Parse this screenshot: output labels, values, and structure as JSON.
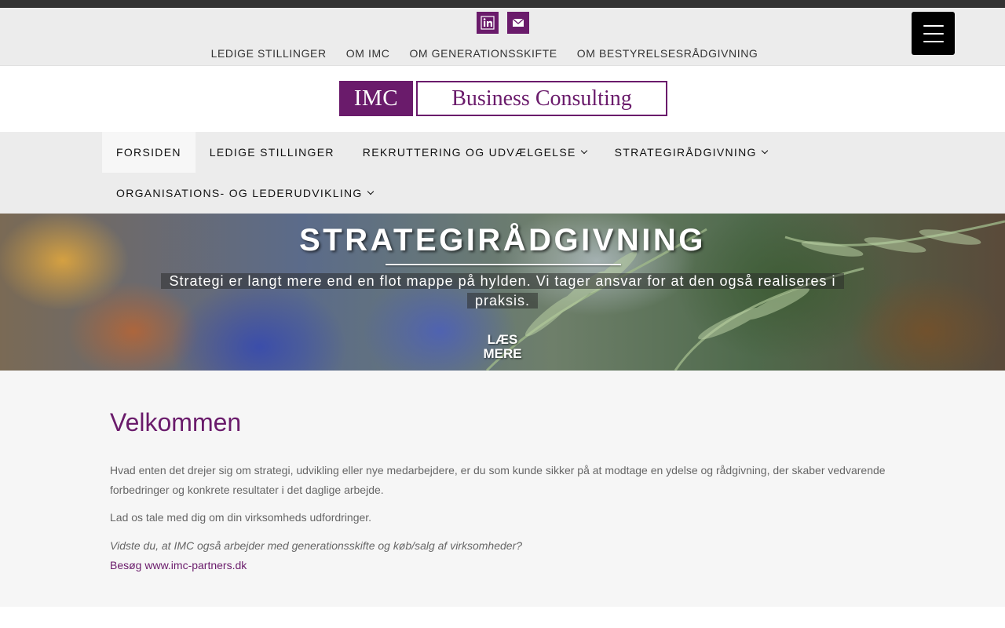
{
  "social": {
    "linkedin_icon": "linkedin-icon",
    "mail_icon": "mail-icon",
    "linkedin_label": "in"
  },
  "topnav": {
    "items": [
      {
        "label": "LEDIGE STILLINGER"
      },
      {
        "label": "OM IMC"
      },
      {
        "label": "OM GENERATIONSSKIFTE"
      },
      {
        "label": "OM BESTYRELSESRÅDGIVNING"
      }
    ]
  },
  "logo": {
    "left": "IMC",
    "right": "Business Consulting",
    "brand_color": "#6a1b6b"
  },
  "mainnav": {
    "items": [
      {
        "label": "FORSIDEN"
      },
      {
        "label": "LEDIGE STILLINGER"
      },
      {
        "label": "REKRUTTERING OG UDVÆLGELSE"
      },
      {
        "label": "STRATEGIRÅDGIVNING"
      },
      {
        "label": "ORGANISATIONS- OG LEDERUDVIKLING"
      }
    ]
  },
  "hero": {
    "title": "STRATEGIRÅDGIVNING",
    "subtitle": "Strategi er langt mere end en flot mappe på hylden. Vi tager ansvar for at den også realiseres i praksis.",
    "read_more_line1": "LÆS",
    "read_more_line2": "MERE"
  },
  "content": {
    "heading": "Velkommen",
    "paragraph1": "Hvad enten det drejer sig om strategi, udvikling eller nye medarbejdere, er du som kunde sikker på at modtage en ydelse og rådgivning, der skaber vedvarende forbedringer og konkrete resultater i det daglige arbejde.",
    "paragraph2": "Lad os tale med dig om din virksomheds udfordringer.",
    "paragraph3": "Vidste du, at IMC også arbejder med generationsskifte og køb/salg af virksomheder?",
    "link": "Besøg www.imc-partners.dk"
  }
}
